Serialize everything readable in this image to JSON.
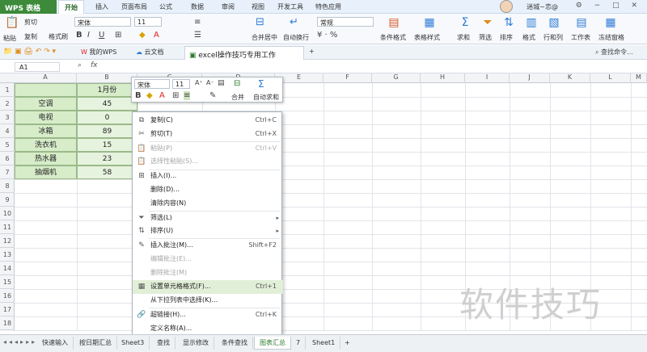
{
  "app": {
    "name": "WPS 表格",
    "user_label": "迷城~恋@",
    "search_label": "查找命令..."
  },
  "menu_tabs": [
    "开始",
    "插入",
    "页面布局",
    "公式",
    "数据",
    "审阅",
    "视图",
    "开发工具",
    "特色应用"
  ],
  "ribbon": {
    "paste": "粘贴",
    "cut": "剪切",
    "copy": "复制",
    "format_painter": "格式刷",
    "font": "宋体",
    "font_size": "11",
    "number_format": "常规",
    "merge_center": "合并居中",
    "auto_wrap": "自动换行",
    "conditional_format": "条件格式",
    "table_style": "表格样式",
    "sum": "求和",
    "filter": "筛选",
    "sort": "排序",
    "format": "格式",
    "row_col": "行和列",
    "worksheet": "工作表",
    "freeze": "冻结窗格"
  },
  "doc_tabs": [
    "我的WPS",
    "云文档",
    "excel操作技巧专用工作簿.xlsx *"
  ],
  "formula_bar": {
    "cell_ref": "A1",
    "fx": "fx"
  },
  "columns": [
    "A",
    "B",
    "C",
    "D",
    "E",
    "F",
    "G",
    "H",
    "I",
    "J",
    "K",
    "L",
    "M",
    "N"
  ],
  "rows": [
    "1",
    "2",
    "3",
    "4",
    "5",
    "6",
    "7",
    "8",
    "9",
    "10",
    "11",
    "12",
    "13",
    "14",
    "15",
    "16",
    "17",
    "18"
  ],
  "table": {
    "header_b": "1月份",
    "items": [
      {
        "name": "空调",
        "value": "45"
      },
      {
        "name": "电视",
        "value": "0"
      },
      {
        "name": "冰箱",
        "value": "89"
      },
      {
        "name": "洗衣机",
        "value": "15"
      },
      {
        "name": "热水器",
        "value": "23"
      },
      {
        "name": "抽烟机",
        "value": "58"
      }
    ]
  },
  "mini_toolbar": {
    "font": "宋体",
    "size": "11",
    "merge": "合并",
    "autosum": "自动求和"
  },
  "context_menu": [
    {
      "label": "复制(C)",
      "shortcut": "Ctrl+C",
      "icon": "copy-icon",
      "disabled": false
    },
    {
      "label": "剪切(T)",
      "shortcut": "Ctrl+X",
      "icon": "scissors-icon",
      "disabled": false
    },
    {
      "label": "粘贴(P)",
      "shortcut": "Ctrl+V",
      "icon": "paste-icon",
      "disabled": true
    },
    {
      "label": "选择性粘贴(S)...",
      "shortcut": "",
      "icon": "paste-special-icon",
      "disabled": true
    },
    {
      "label": "插入(I)...",
      "shortcut": "",
      "icon": "insert-icon",
      "disabled": false
    },
    {
      "label": "删除(D)...",
      "shortcut": "",
      "icon": "",
      "disabled": false
    },
    {
      "label": "清除内容(N)",
      "shortcut": "",
      "icon": "",
      "disabled": false
    },
    {
      "label": "筛选(L)",
      "shortcut": "",
      "icon": "filter-icon",
      "disabled": false,
      "submenu": true
    },
    {
      "label": "排序(U)",
      "shortcut": "",
      "icon": "sort-icon",
      "disabled": false,
      "submenu": true
    },
    {
      "label": "插入批注(M)...",
      "shortcut": "Shift+F2",
      "icon": "comment-icon",
      "disabled": false
    },
    {
      "label": "编辑批注(E)...",
      "shortcut": "",
      "icon": "",
      "disabled": true
    },
    {
      "label": "删除批注(M)",
      "shortcut": "",
      "icon": "",
      "disabled": true
    },
    {
      "label": "设置单元格格式(F)...",
      "shortcut": "Ctrl+1",
      "icon": "format-cells-icon",
      "disabled": false,
      "highlight": true
    },
    {
      "label": "从下拉列表中选择(K)...",
      "shortcut": "",
      "icon": "",
      "disabled": false
    },
    {
      "label": "超链接(H)...",
      "shortcut": "Ctrl+K",
      "icon": "link-icon",
      "disabled": false
    },
    {
      "label": "定义名称(A)...",
      "shortcut": "",
      "icon": "",
      "disabled": false
    }
  ],
  "sheet_tabs": [
    "快速输入",
    "按日期汇总",
    "Sheet3",
    "查找",
    "显示修改",
    "条件查找",
    "图表汇总",
    "7",
    "Sheet1"
  ],
  "active_sheet": "图表汇总",
  "watermark": "软件技巧"
}
